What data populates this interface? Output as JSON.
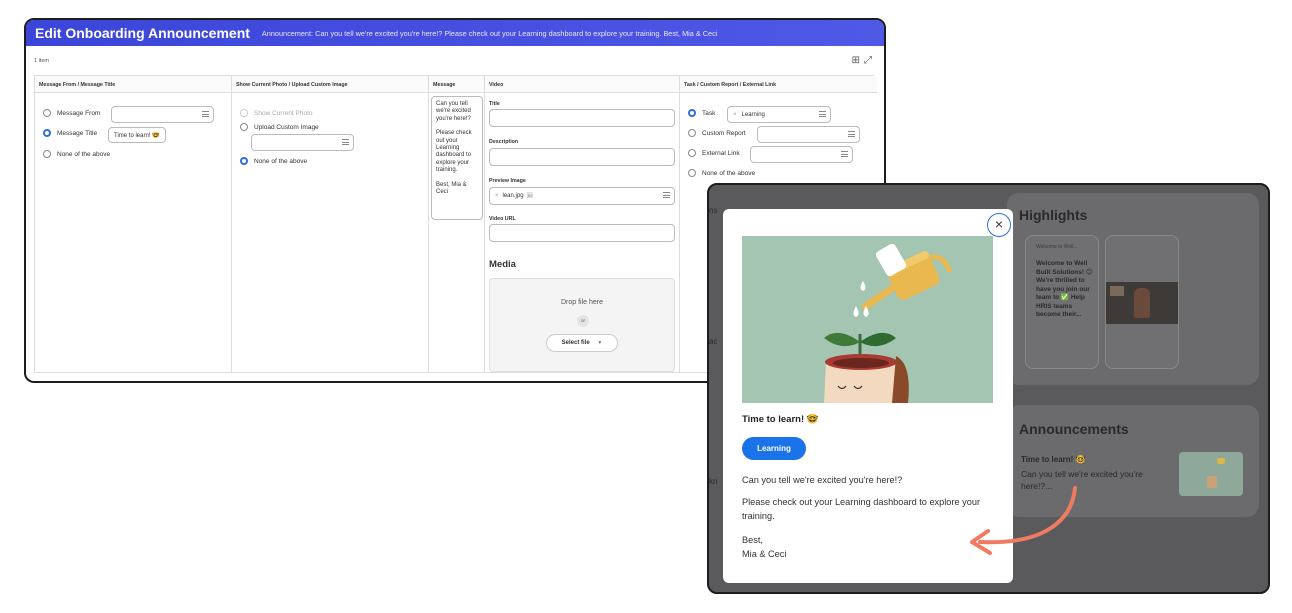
{
  "editor": {
    "title": "Edit Onboarding Announcement",
    "subtitle": "Announcement: Can you tell we're excited you're here!? Please check out your Learning dashboard to explore your training. Best, Mia & Ceci",
    "item_count": "1 item",
    "columns": {
      "col1": "Message From / Message Title",
      "col2": "Show Current Photo / Upload Custom Image",
      "col3": "Message",
      "col4": "Video",
      "col5": "Task / Custom Report / External Link"
    },
    "message_from": {
      "opt_from": "Message From",
      "opt_title": "Message Title",
      "opt_none": "None of the above",
      "title_value": "Time to learn! 🤓"
    },
    "photo": {
      "opt_current": "Show Current Photo",
      "opt_upload": "Upload Custom Image",
      "opt_none": "None of the above"
    },
    "message": {
      "p1": "Can you tell we're excited you're here!?",
      "p2": "Please check out your Learning dashboard to explore your training.",
      "p3": "Best, Mia & Ceci"
    },
    "video": {
      "title_label": "Title",
      "description_label": "Description",
      "preview_label": "Preview Image",
      "preview_file": "lean.jpg",
      "url_label": "Video URL",
      "media_title": "Media",
      "drop_text": "Drop file here",
      "or_text": "or",
      "select_file": "Select file"
    },
    "task": {
      "opt_task": "Task",
      "task_value": "Learning",
      "opt_report": "Custom Report",
      "opt_link": "External Link",
      "opt_none": "None of the above"
    }
  },
  "overlay": {
    "highlights_title": "Highlights",
    "highlight_card_caption": "Welcome to Well...",
    "highlight_card_text": "Welcome to Well Built Solutions! 😊 We're thrilled to have you join our team to ✅ Help HRIS teams become their...",
    "announcements_title": "Announcements",
    "ann_title": "Time to learn! 🤓",
    "ann_text": "Can you tell we're excited you're here!?...",
    "modal": {
      "close": "×",
      "title": "Time to learn! 🤓",
      "button": "Learning",
      "p1": "Can you tell we're excited you're here!?",
      "p2": "Please check out your Learning dashboard to explore your training.",
      "p3a": "Best,",
      "p3b": "Mia & Ceci"
    }
  },
  "colors": {
    "header_blue": "#3b45d9",
    "radio_selected": "#2a6fdb",
    "primary_button": "#1a73e8",
    "arrow": "#f07a62",
    "hero_bg": "#a3c5b2"
  }
}
